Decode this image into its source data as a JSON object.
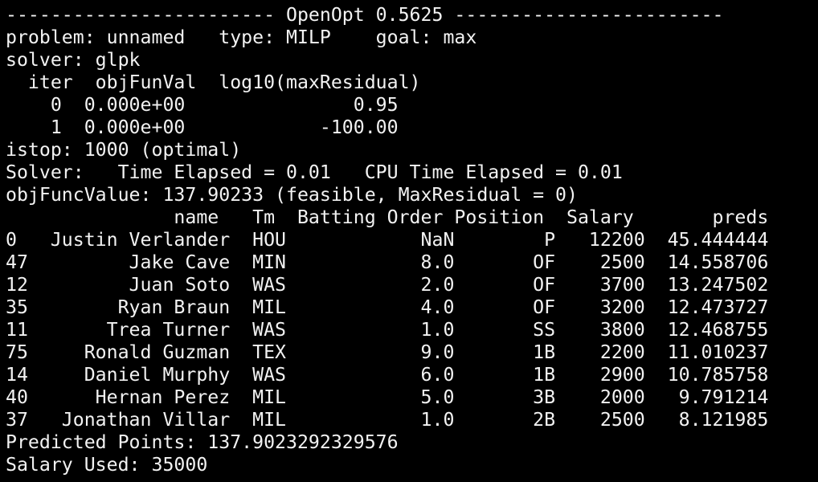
{
  "terminal": {
    "lines": [
      "------------------------ OpenOpt 0.5625 ------------------------",
      "problem: unnamed   type: MILP    goal: max",
      "solver: glpk",
      "  iter  objFunVal  log10(maxResidual)",
      "    0  0.000e+00               0.95",
      "    1  0.000e+00            -100.00",
      "istop: 1000 (optimal)",
      "Solver:   Time Elapsed = 0.01   CPU Time Elapsed = 0.01",
      "objFuncValue: 137.90233 (feasible, MaxResidual = 0)",
      "               name   Tm  Batting Order Position  Salary       preds",
      "0   Justin Verlander  HOU            NaN        P   12200  45.444444",
      "47         Jake Cave  MIN            8.0       OF    2500  14.558706",
      "12         Juan Soto  WAS            2.0       OF    3700  13.247502",
      "35        Ryan Braun  MIL            4.0       OF    3200  12.473727",
      "11       Trea Turner  WAS            1.0       SS    3800  12.468755",
      "75     Ronald Guzman  TEX            9.0       1B    2200  11.010237",
      "14     Daniel Murphy  WAS            6.0       1B    2900  10.785758",
      "40      Hernan Perez  MIL            5.0       3B    2000   9.791214",
      "37   Jonathan Villar  MIL            1.0       2B    2500   8.121985",
      "Predicted Points: 137.9023292329576",
      "Salary Used: 35000"
    ]
  }
}
